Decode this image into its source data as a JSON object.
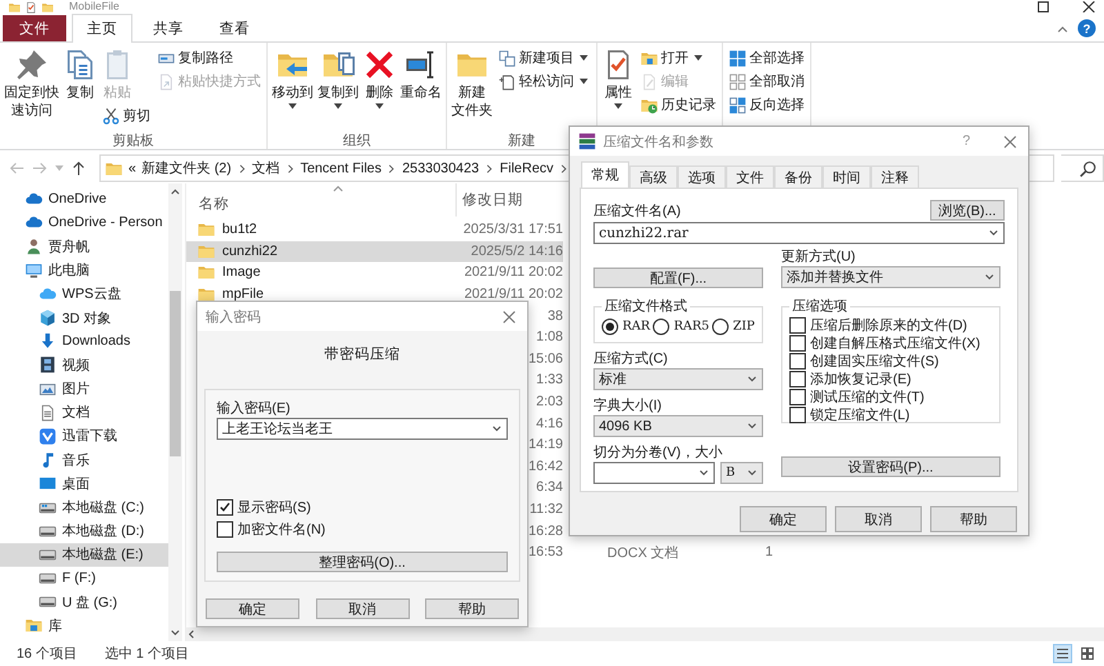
{
  "window": {
    "title": "MobileFile"
  },
  "ribbon_tabs": [
    {
      "label": "文件",
      "kind": "file",
      "selected": false
    },
    {
      "label": "主页",
      "kind": "tab",
      "selected": true
    },
    {
      "label": "共享",
      "kind": "tab",
      "selected": false
    },
    {
      "label": "查看",
      "kind": "tab",
      "selected": false
    }
  ],
  "ribbon_help": "?",
  "ribbon_groups": [
    {
      "label": "剪贴板",
      "columns": [
        {
          "items": [
            {
              "kind": "large",
              "lines": [
                "固定到快",
                "速访问"
              ],
              "disabled": false,
              "dropdown": false
            }
          ]
        },
        {
          "items": [
            {
              "kind": "large",
              "lines": [
                "复制"
              ],
              "disabled": false,
              "dropdown": false
            }
          ]
        },
        {
          "items": [
            {
              "kind": "large",
              "lines": [
                "粘贴"
              ],
              "disabled": true,
              "dropdown": false
            },
            {
              "kind": "small",
              "label": "剪切",
              "disabled": false,
              "dropdown": false
            }
          ]
        },
        {
          "items": [
            {
              "kind": "small",
              "label": "复制路径",
              "disabled": false,
              "dropdown": false
            },
            {
              "kind": "small",
              "label": "粘贴快捷方式",
              "disabled": true,
              "dropdown": false
            }
          ]
        }
      ]
    },
    {
      "label": "组织",
      "columns": [
        {
          "items": [
            {
              "kind": "large",
              "lines": [
                "移动到"
              ],
              "disabled": false,
              "dropdown": true
            }
          ]
        },
        {
          "items": [
            {
              "kind": "large",
              "lines": [
                "复制到"
              ],
              "disabled": false,
              "dropdown": true
            }
          ]
        },
        {
          "items": [
            {
              "kind": "large",
              "lines": [
                "删除"
              ],
              "disabled": false,
              "dropdown": true
            }
          ]
        },
        {
          "items": [
            {
              "kind": "large",
              "lines": [
                "重命名"
              ],
              "disabled": false,
              "dropdown": false
            }
          ]
        }
      ]
    },
    {
      "label": "新建",
      "columns": [
        {
          "items": [
            {
              "kind": "large",
              "lines": [
                "新建",
                "文件夹"
              ],
              "disabled": false,
              "dropdown": false
            }
          ]
        },
        {
          "items": [
            {
              "kind": "small",
              "label": "新建项目",
              "disabled": false,
              "dropdown": true
            },
            {
              "kind": "small",
              "label": "轻松访问",
              "disabled": false,
              "dropdown": true
            }
          ]
        }
      ]
    },
    {
      "columns": [
        {
          "items": [
            {
              "kind": "large",
              "lines": [
                "属性"
              ],
              "disabled": false,
              "dropdown": true
            }
          ]
        },
        {
          "items": [
            {
              "kind": "small",
              "label": "打开",
              "disabled": false,
              "dropdown": true
            },
            {
              "kind": "small",
              "label": "编辑",
              "disabled": true,
              "dropdown": false
            },
            {
              "kind": "small",
              "label": "历史记录",
              "disabled": false,
              "dropdown": false
            }
          ]
        }
      ]
    },
    {
      "columns": [
        {
          "items": [
            {
              "kind": "small",
              "label": "全部选择",
              "disabled": false,
              "dropdown": false
            },
            {
              "kind": "small",
              "label": "全部取消",
              "disabled": false,
              "dropdown": false
            },
            {
              "kind": "small",
              "label": "反向选择",
              "disabled": false,
              "dropdown": false
            }
          ]
        }
      ]
    }
  ],
  "address": {
    "overflow_mark": "«",
    "crumbs": [
      "新建文件夹 (2)",
      "文档",
      "Tencent Files",
      "2533030423",
      "FileRecv"
    ]
  },
  "sidebar": {
    "items": [
      {
        "label": "OneDrive",
        "selected": false
      },
      {
        "label": "OneDrive - Person",
        "selected": false
      },
      {
        "label": "贾舟帆",
        "selected": false
      },
      {
        "label": "此电脑",
        "selected": false,
        "children": [
          {
            "label": "WPS云盘",
            "selected": false
          },
          {
            "label": "3D 对象",
            "selected": false
          },
          {
            "label": "Downloads",
            "selected": false
          },
          {
            "label": "视频",
            "selected": false
          },
          {
            "label": "图片",
            "selected": false
          },
          {
            "label": "文档",
            "selected": false
          },
          {
            "label": "迅雷下载",
            "selected": false
          },
          {
            "label": "音乐",
            "selected": false
          },
          {
            "label": "桌面",
            "selected": false
          },
          {
            "label": "本地磁盘 (C:)",
            "selected": false
          },
          {
            "label": "本地磁盘 (D:)",
            "selected": false
          },
          {
            "label": "本地磁盘 (E:)",
            "selected": true
          },
          {
            "label": "F (F:)",
            "selected": false
          },
          {
            "label": "U 盘 (G:)",
            "selected": false
          }
        ]
      },
      {
        "label": "库",
        "selected": false
      }
    ]
  },
  "file_list": {
    "columns": [
      "名称",
      "修改日期"
    ],
    "rows": [
      {
        "name": "bu1t2",
        "date": "2025/3/31 17:51",
        "selected": false
      },
      {
        "name": "cunzhi22",
        "date": "2025/5/2 14:16",
        "selected": true
      },
      {
        "name": "Image",
        "date": "2021/9/11 20:02",
        "selected": false
      },
      {
        "name": "mpFile",
        "date": "2021/9/11 20:02",
        "selected": false
      },
      {
        "date": "38",
        "selected": false
      },
      {
        "date": "1:08",
        "selected": false
      },
      {
        "date": "15:06",
        "selected": false
      },
      {
        "date": "1:33",
        "selected": false
      },
      {
        "date": "2:03",
        "selected": false
      },
      {
        "date": "4:16",
        "selected": false
      },
      {
        "date": "14:19",
        "selected": false
      },
      {
        "date": "16:42",
        "selected": false
      },
      {
        "date": "6:34",
        "selected": false
      },
      {
        "date": "11:32",
        "selected": false
      },
      {
        "date": "16:28",
        "selected": false
      },
      {
        "date": "16:53",
        "type": "DOCX 文档",
        "size": "1",
        "selected": false
      }
    ]
  },
  "status_bar": {
    "item_count": "16 个项目",
    "selection": "选中 1 个项目"
  },
  "password_dialog": {
    "title": "输入密码",
    "heading": "带密码压缩",
    "password_label": "输入密码(E)",
    "password": "上老王论坛当老王",
    "options": [
      {
        "label": "显示密码(S)",
        "checked": true
      },
      {
        "label": "加密文件名(N)",
        "checked": false
      }
    ],
    "organize_button": "整理密码(O)...",
    "buttons": [
      "确定",
      "取消",
      "帮助"
    ]
  },
  "rar_dialog": {
    "title": "压缩文件名和参数",
    "help_mark": "?",
    "tabs": [
      {
        "label": "常规",
        "selected": true
      },
      {
        "label": "高级",
        "selected": false
      },
      {
        "label": "选项",
        "selected": false
      },
      {
        "label": "文件",
        "selected": false
      },
      {
        "label": "备份",
        "selected": false
      },
      {
        "label": "时间",
        "selected": false
      },
      {
        "label": "注释",
        "selected": false
      }
    ],
    "archive_name_label": "压缩文件名(A)",
    "browse_button": "浏览(B)...",
    "archive_name": "cunzhi22.rar",
    "profiles_button": "配置(F)...",
    "update_mode_label": "更新方式(U)",
    "update_mode": "添加并替换文件",
    "format_group": {
      "title": "压缩文件格式",
      "options": [
        {
          "label": "RAR",
          "selected": true
        },
        {
          "label": "RAR5",
          "selected": false
        },
        {
          "label": "ZIP",
          "selected": false
        }
      ]
    },
    "method_label": "压缩方式(C)",
    "method": "标准",
    "dictionary_label": "字典大小(I)",
    "dictionary": "4096 KB",
    "split_label": "切分为分卷(V)，大小",
    "split_unit": "B",
    "options_group": {
      "title": "压缩选项",
      "options": [
        {
          "label": "压缩后删除原来的文件(D)",
          "checked": false
        },
        {
          "label": "创建自解压格式压缩文件(X)",
          "checked": false
        },
        {
          "label": "创建固实压缩文件(S)",
          "checked": false
        },
        {
          "label": "添加恢复记录(E)",
          "checked": false
        },
        {
          "label": "测试压缩的文件(T)",
          "checked": false
        },
        {
          "label": "锁定压缩文件(L)",
          "checked": false
        }
      ]
    },
    "password_button": "设置密码(P)...",
    "buttons": [
      "确定",
      "取消",
      "帮助"
    ]
  }
}
